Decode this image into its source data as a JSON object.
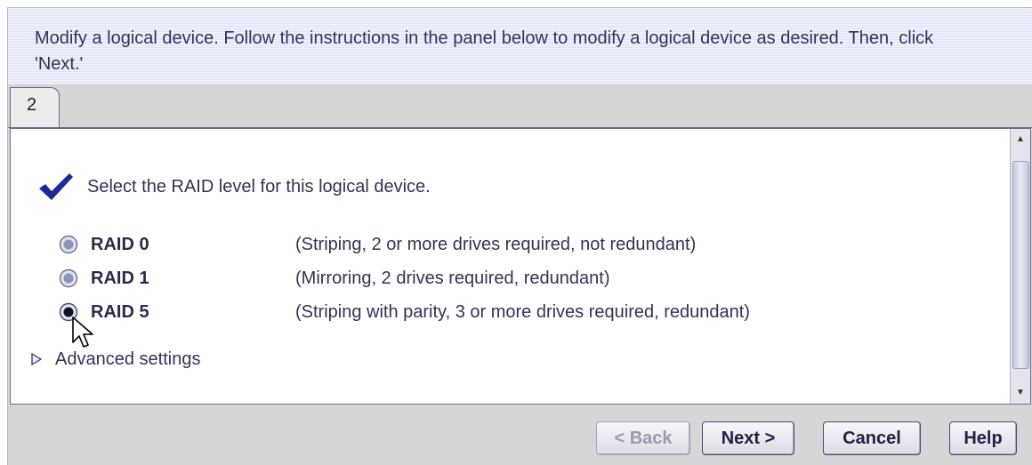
{
  "instructions": {
    "text": "Modify a logical device.  Follow the instructions in the panel below to modify a logical device as desired.  Then, click 'Next.'"
  },
  "tabs": [
    {
      "label": "2",
      "selected": true
    }
  ],
  "step": {
    "instruction": "Select the RAID level for this logical device.",
    "icon": "checkmark-icon"
  },
  "raid_options": [
    {
      "label": "RAID 0",
      "description": "(Striping, 2 or more drives required, not redundant)",
      "selected": false
    },
    {
      "label": "RAID 1",
      "description": "(Mirroring, 2 drives required, redundant)",
      "selected": false
    },
    {
      "label": "RAID 5",
      "description": "(Striping with parity, 3 or more drives required, redundant)",
      "selected": true
    }
  ],
  "advanced": {
    "label": "Advanced settings",
    "expanded": false
  },
  "buttons": {
    "back": {
      "label": "< Back",
      "enabled": false
    },
    "next": {
      "label": "Next >",
      "enabled": true
    },
    "cancel": {
      "label": "Cancel",
      "enabled": true
    },
    "help": {
      "label": "Help",
      "enabled": true
    }
  },
  "colors": {
    "accent": "#1a2a9a",
    "text": "#333355",
    "header_stripe": "#dde3f6"
  }
}
